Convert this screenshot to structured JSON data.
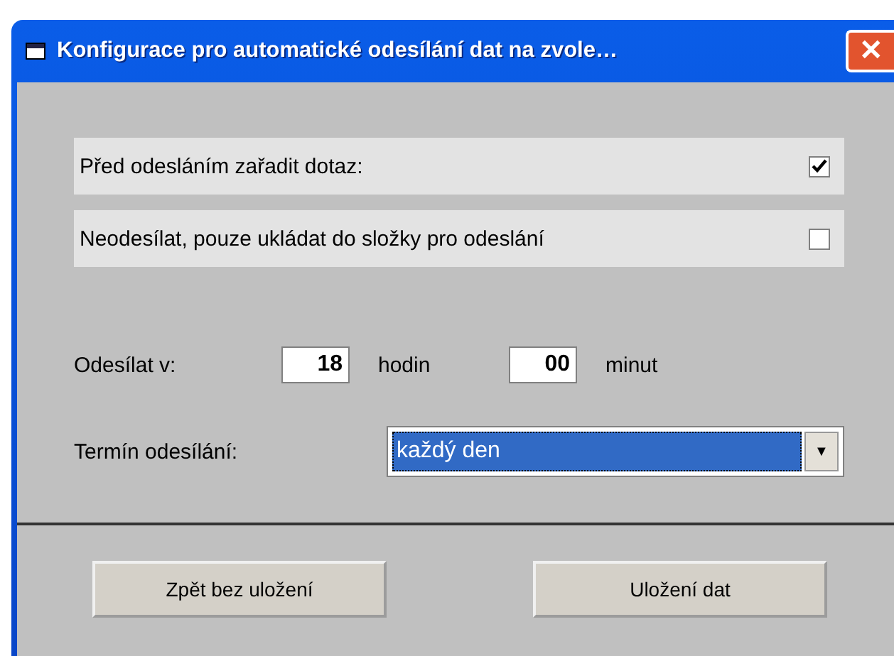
{
  "window": {
    "title": "Konfigurace pro automatické odesílání dat na zvole…",
    "close": "✕"
  },
  "options": [
    {
      "label": "Před odesláním zařadit dotaz:",
      "checked": true
    },
    {
      "label": "Neodesílat, pouze ukládat do složky pro odeslání",
      "checked": false
    }
  ],
  "send_time": {
    "label": "Odesílat v:",
    "hours": "18",
    "hours_unit": "hodin",
    "minutes": "00",
    "minutes_unit": "minut"
  },
  "schedule": {
    "label": "Termín odesílání:",
    "value": "každý den",
    "arrow": "▼"
  },
  "buttons": [
    "Zpět bez uložení",
    "Uložení dat"
  ]
}
